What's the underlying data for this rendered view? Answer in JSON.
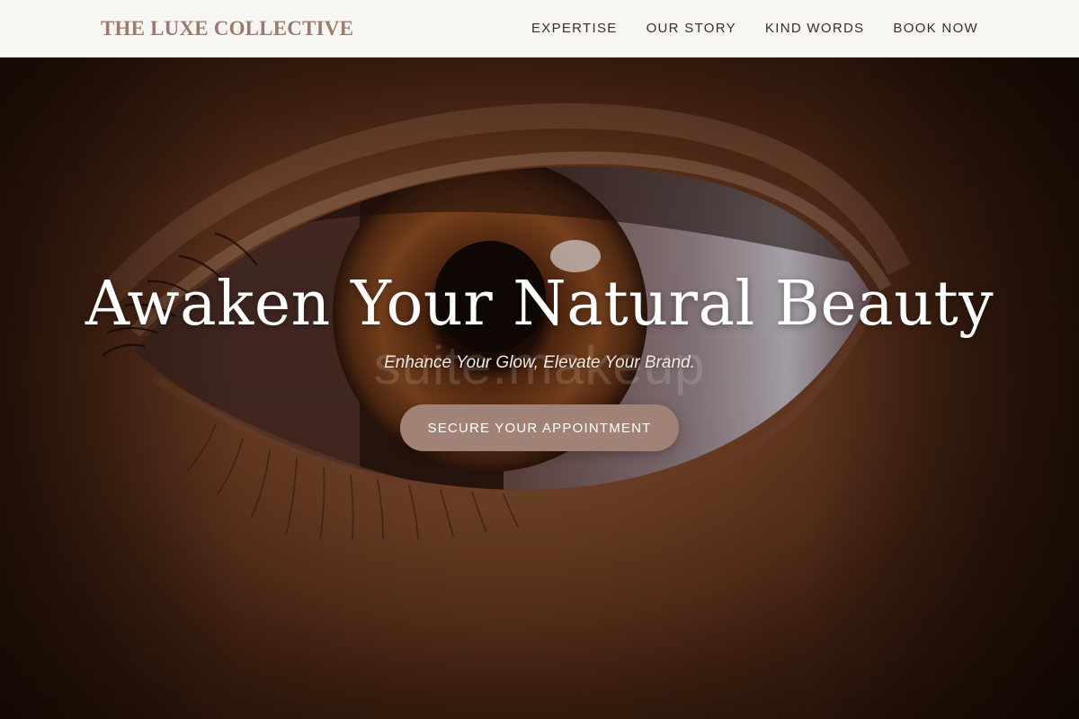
{
  "brand": {
    "name": "THE LUXE COLLECTIVE"
  },
  "nav": {
    "items": [
      {
        "label": "EXPERTISE"
      },
      {
        "label": "OUR STORY"
      },
      {
        "label": "KIND WORDS"
      },
      {
        "label": "BOOK NOW"
      }
    ]
  },
  "hero": {
    "title": "Awaken Your Natural Beauty",
    "subtitle": "Enhance Your Glow, Elevate Your Brand.",
    "cta_label": "SECURE YOUR APPOINTMENT",
    "watermark": "suite.makeup",
    "image_subject": "close-up of a brown eye"
  },
  "colors": {
    "navbar_bg": "#f8f6f3",
    "brand_text": "#9a7b6e",
    "nav_text": "#3a2e2a",
    "cta_bg": "#a08276",
    "hero_text": "#ffffff"
  }
}
